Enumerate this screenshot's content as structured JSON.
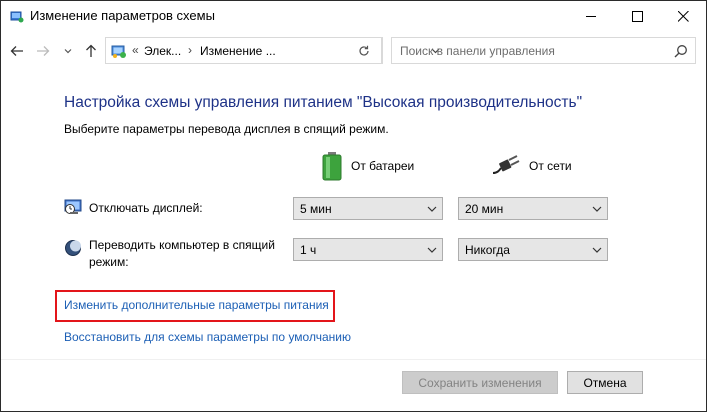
{
  "window": {
    "title": "Изменение параметров схемы"
  },
  "nav": {
    "breadcrumbs": [
      "Элек...",
      "Изменение ..."
    ],
    "search_placeholder": "Поиск в панели управления"
  },
  "content": {
    "heading": "Настройка схемы управления питанием \"Высокая производительность\"",
    "subtext": "Выберите параметры перевода дисплея в спящий режим.",
    "columns": {
      "battery": "От батареи",
      "ac": "От сети"
    },
    "rows": [
      {
        "label": "Отключать дисплей:",
        "battery": "5 мин",
        "ac": "20 мин"
      },
      {
        "label": "Переводить компьютер в спящий режим:",
        "battery": "1 ч",
        "ac": "Никогда"
      }
    ],
    "links": {
      "advanced": "Изменить дополнительные параметры питания",
      "restore": "Восстановить для схемы параметры по умолчанию"
    }
  },
  "footer": {
    "save": "Сохранить изменения",
    "cancel": "Отмена"
  },
  "colors": {
    "heading": "#1e3287",
    "link": "#1c5fb5",
    "highlight": "#e3151a"
  }
}
